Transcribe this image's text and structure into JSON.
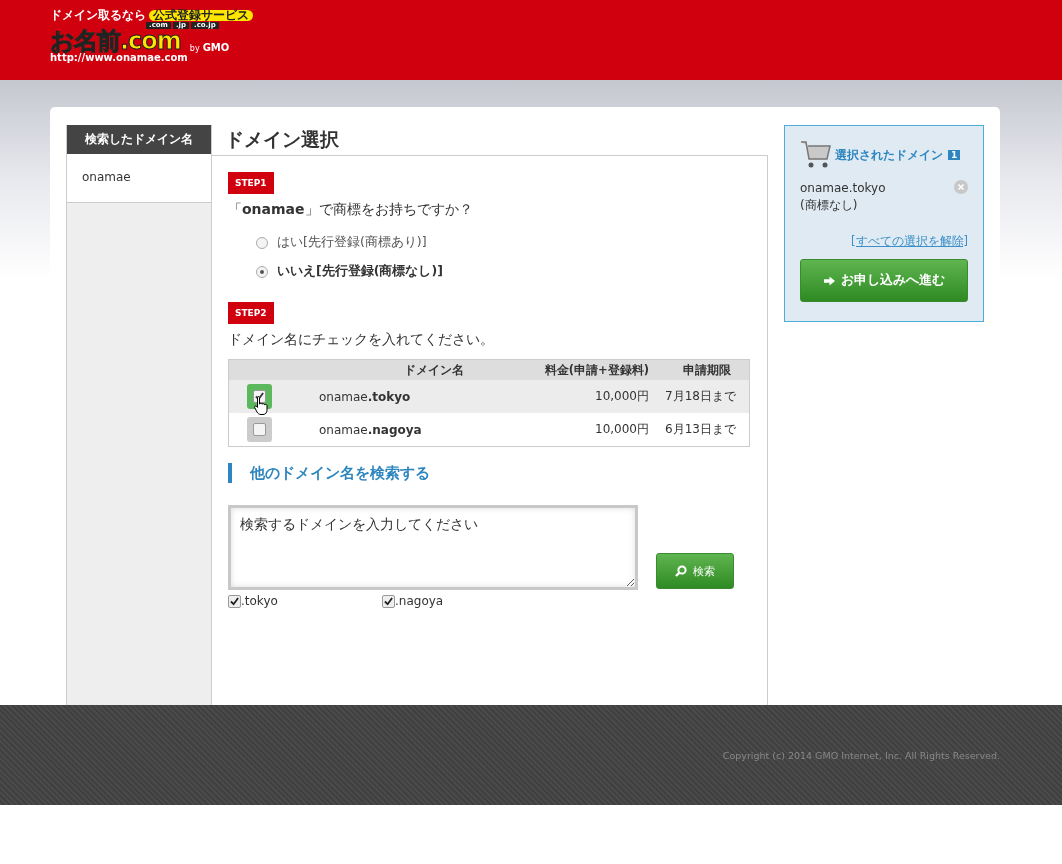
{
  "logo": {
    "tagline": "ドメイン取るなら",
    "badge": "公式登録サービス",
    "tlds": [
      ".com",
      ".jp",
      ".co.jp"
    ],
    "name": "お名前.com",
    "url": "http://www.onamae.com",
    "by": "by",
    "gmo": "GMO"
  },
  "sidebar": {
    "title": "検索したドメイン名",
    "items": [
      {
        "label": "onamae",
        "selected": true
      }
    ]
  },
  "page_title": "ドメイン選択",
  "step1": {
    "badge": "STEP1",
    "question": "「**onamae**」で商標をお持ちですか？",
    "options": [
      {
        "label": "はい[先行登録(商標あり)]",
        "selected": false
      },
      {
        "label": "いいえ[先行登録(商標なし)]",
        "selected": true
      }
    ]
  },
  "step2": {
    "badge": "STEP2",
    "instruction": "ドメイン名にチェックを入れてください。",
    "table": {
      "columns": [
        "ドメイン名",
        "料金(申請+登録料)",
        "申請期限"
      ],
      "rows": [
        {
          "checked": true,
          "domain": "onamae**.tokyo**",
          "price": "10,000円",
          "deadline": "7月18日まで"
        },
        {
          "checked": false,
          "domain": "onamae**.nagoya**",
          "price": "10,000円",
          "deadline": "6月13日まで"
        }
      ]
    }
  },
  "search": {
    "heading": "他のドメイン名を検索する",
    "placeholder": "検索するドメインを入力してください",
    "button": "検索",
    "tlds": [
      {
        "label": ".tokyo",
        "checked": true
      },
      {
        "label": ".nagoya",
        "checked": true
      }
    ]
  },
  "cart": {
    "title": "選択されたドメイン",
    "count": "1",
    "items": [
      {
        "domain": "onamae.tokyo",
        "note": "(商標なし)"
      }
    ],
    "clear_link": "[すべての選択を解除]",
    "proceed_button": "お申し込みへ進む"
  },
  "footer": {
    "copyright": "Copyright (c) 2014 GMO Internet, Inc. All Rights Reserved."
  }
}
